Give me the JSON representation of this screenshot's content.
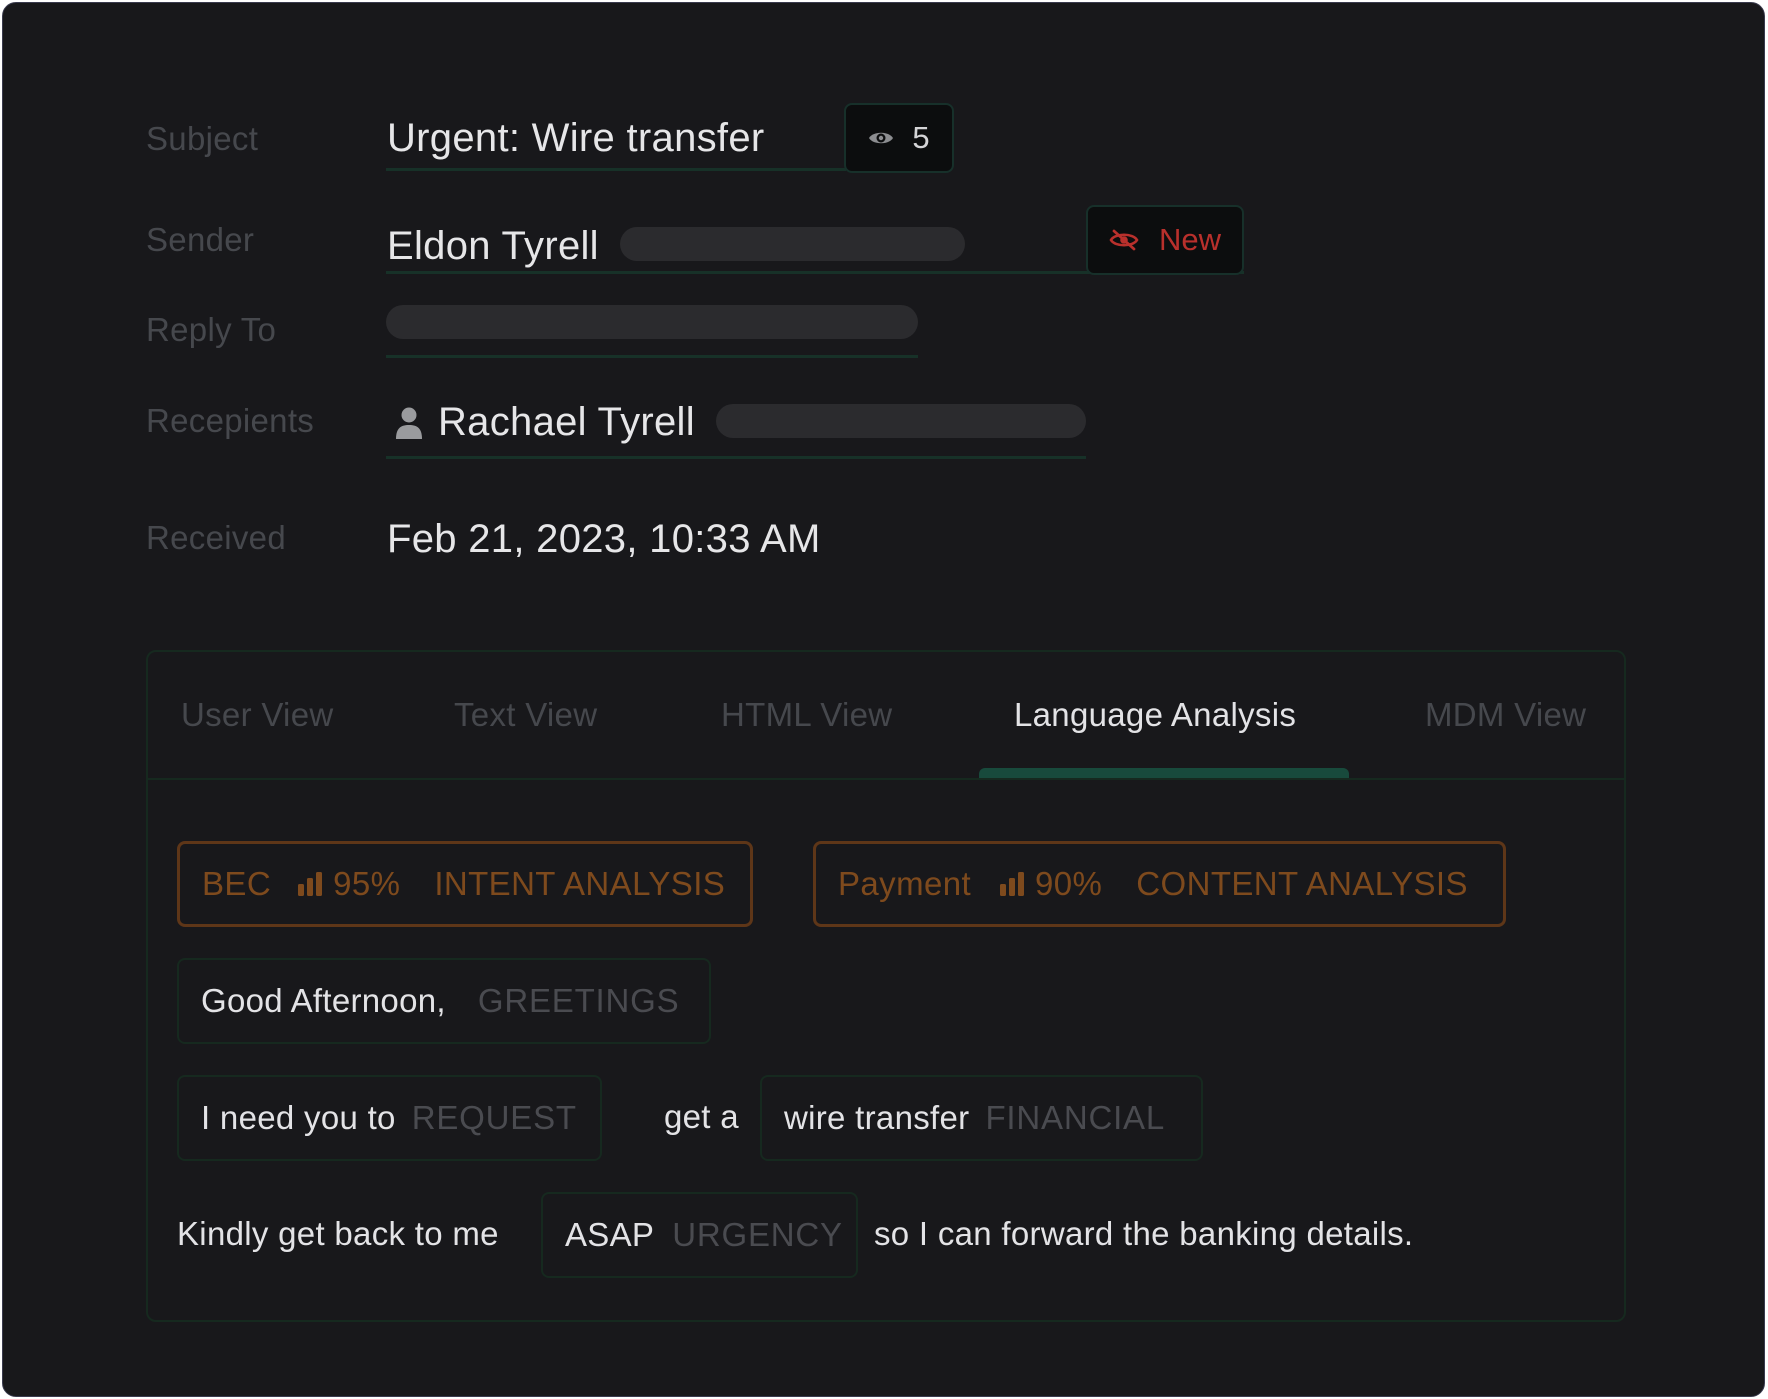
{
  "labels": {
    "subject": "Subject",
    "sender": "Sender",
    "reply_to": "Reply To",
    "recipients": "Recepients",
    "received": "Received"
  },
  "email": {
    "subject": "Urgent: Wire transfer",
    "views_count": "5",
    "sender_name": "Eldon Tyrell",
    "sender_badge": "New",
    "recipient_name": "Rachael Tyrell",
    "received": "Feb 21, 2023, 10:33 AM"
  },
  "tabs": [
    {
      "label": "User View"
    },
    {
      "label": "Text View"
    },
    {
      "label": "HTML View"
    },
    {
      "label": "Language Analysis"
    },
    {
      "label": "MDM View"
    }
  ],
  "active_tab": "Language Analysis",
  "analysis": {
    "intent": {
      "label": "BEC",
      "score": "95%",
      "category": "INTENT ANALYSIS"
    },
    "content": {
      "label": "Payment",
      "score": "90%",
      "category": "CONTENT ANALYSIS"
    },
    "greeting": {
      "phrase": "Good Afternoon,",
      "category": "GREETINGS"
    },
    "request": {
      "phrase": "I need you to",
      "category": "REQUEST"
    },
    "connector1": "get a",
    "financial": {
      "phrase": "wire transfer",
      "category": "FINANCIAL"
    },
    "prefix": "Kindly get back to me",
    "urgency": {
      "phrase": "ASAP",
      "category": "URGENCY"
    },
    "suffix": "so I can forward the banking details."
  },
  "colors": {
    "background": "#18181b",
    "accent_green": "#184a3c",
    "alert_red": "#b9302c",
    "analysis_orange": "#7e4a1d"
  },
  "icons": {
    "views": "eye-icon",
    "new": "eye-slash-icon",
    "recipient": "person-icon",
    "score": "bar-chart-icon"
  }
}
